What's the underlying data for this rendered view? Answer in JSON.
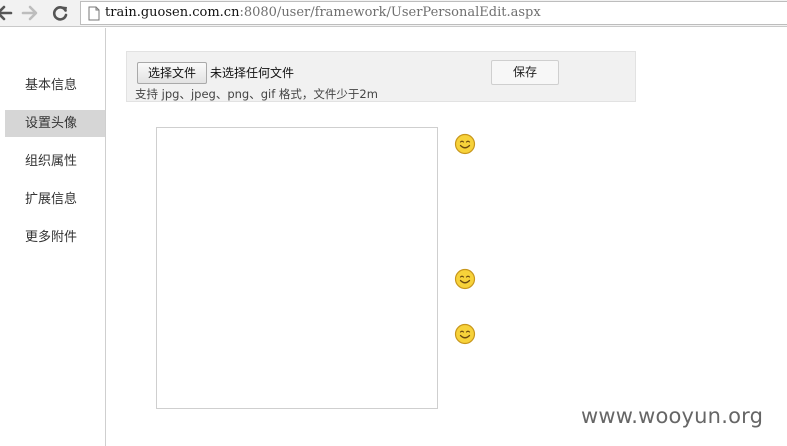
{
  "browser": {
    "url_host": "train.guosen.com.cn",
    "url_rest": ":8080/user/framework/UserPersonalEdit.aspx"
  },
  "sidebar": {
    "items": [
      {
        "label": "基本信息"
      },
      {
        "label": "设置头像"
      },
      {
        "label": "组织属性"
      },
      {
        "label": "扩展信息"
      },
      {
        "label": "更多附件"
      }
    ],
    "active_index": 1
  },
  "upload": {
    "choose_label": "选择文件",
    "file_status": "未选择任何文件",
    "save_label": "保存",
    "hint": "支持 jpg、jpeg、png、gif 格式，文件少于2m"
  },
  "icons": {
    "back": "back-arrow-icon",
    "forward": "forward-arrow-icon",
    "reload": "reload-icon",
    "page": "page-icon",
    "smiley": "smiley-icon"
  },
  "colors": {
    "sidebar_active_bg": "#d6d6d6",
    "smiley_fill": "#f7d23a"
  },
  "watermark": "www.wooyun.org"
}
